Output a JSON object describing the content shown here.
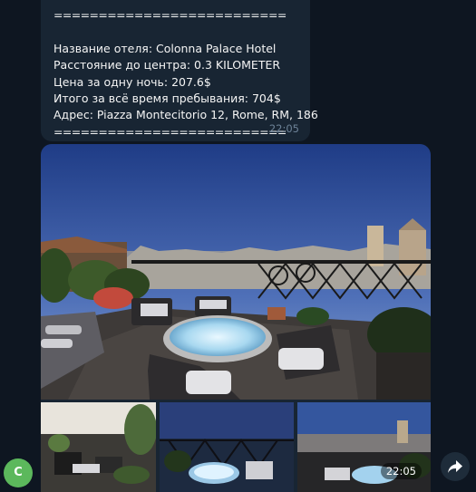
{
  "message": {
    "separator_top": "==========================",
    "hotel_line": "Название отеля: Colonna Palace Hotel",
    "distance_line": "Расстояние до центра: 0.3 KILOMETER",
    "price_line": "Цена за одну ночь: 207.6$",
    "total_line": "Итого за всё время пребывания: 704$",
    "address_line": "Адрес: Piazza Montecitorio 12, Rome, RM, 186",
    "separator_bottom": "==========================",
    "time": "22:05"
  },
  "album": {
    "time": "22:05"
  },
  "sender": {
    "avatar_letter": "C",
    "avatar_color": "#5cb85c"
  },
  "colors": {
    "chat_background": "#0e1621",
    "bubble_background": "#182533",
    "timestamp": "#6d8297"
  },
  "icons": {
    "share": "share-arrow-icon"
  }
}
